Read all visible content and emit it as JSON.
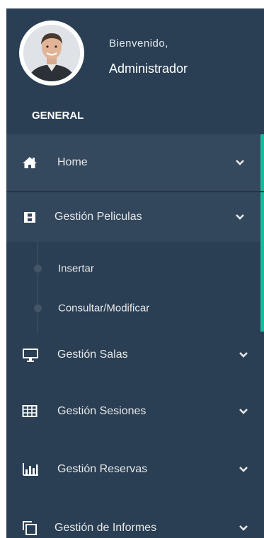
{
  "profile": {
    "welcome": "Bienvenido,",
    "name": "Administrador"
  },
  "section": {
    "title": "GENERAL"
  },
  "menu": {
    "home": {
      "label": "Home",
      "icon": "home-icon"
    },
    "peliculas": {
      "label": "Gestión Peliculas",
      "icon": "film-icon"
    },
    "peliculas_sub": [
      {
        "label": "Insertar"
      },
      {
        "label": "Consultar/Modificar"
      }
    ],
    "salas": {
      "label": "Gestión Salas",
      "icon": "desktop-icon"
    },
    "sesiones": {
      "label": "Gestión Sesiones",
      "icon": "table-icon"
    },
    "reservas": {
      "label": "Gestión Reservas",
      "icon": "bar-chart-icon"
    },
    "informes": {
      "label": "Gestión de Informes",
      "icon": "clone-icon"
    }
  },
  "colors": {
    "sidebar_bg": "#2a3f54",
    "active_bg": "#35495e",
    "accent": "#1abb9c",
    "text": "#e7e7e7"
  }
}
